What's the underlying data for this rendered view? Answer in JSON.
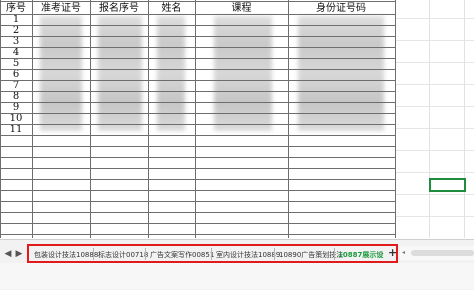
{
  "columns": [
    "序号",
    "准考证号",
    "报名序号",
    "姓名",
    "课程",
    "身份证号码"
  ],
  "rows": [
    "1",
    "2",
    "3",
    "4",
    "5",
    "6",
    "7",
    "8",
    "9",
    "10",
    "11"
  ],
  "sheet_tabs": [
    {
      "label": "包装设计技法10888",
      "active": false
    },
    {
      "label": "标志设计00718",
      "active": false
    },
    {
      "label": "广告文案写作00851",
      "active": false
    },
    {
      "label": "室内设计技法10889",
      "active": false
    },
    {
      "label": "10890广告策划技法",
      "active": false
    },
    {
      "label": "10887展示设",
      "active": true
    }
  ],
  "nav": {
    "prev": "◀",
    "next": "▶"
  },
  "more": "···",
  "add": "+",
  "colors": {
    "active_tab": "#1a9c3e",
    "highlight_border": "#e11b1b",
    "selection": "#1e8e3e"
  }
}
